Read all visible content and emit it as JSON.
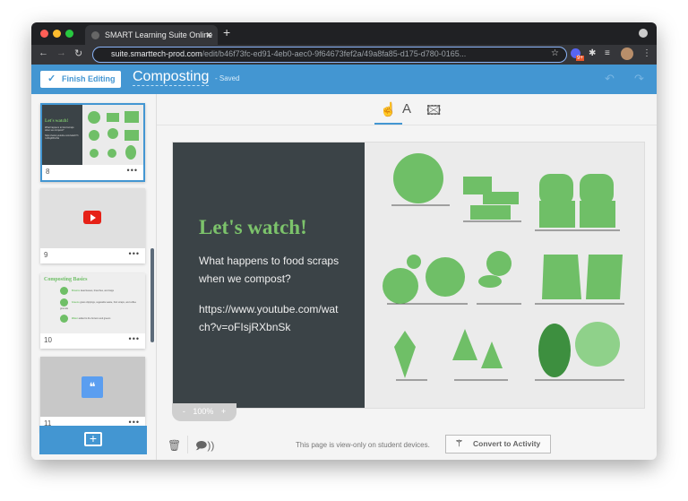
{
  "browser": {
    "tab_title": "SMART Learning Suite Online",
    "url_domain": "suite.smarttech-prod.com",
    "url_path": "/edit/b46f73fc-ed91-4eb0-aec0-9f64673fef2a/49a8fa85-d175-d780-0165...",
    "ext_badge": "9+"
  },
  "header": {
    "finish_label": "Finish Editing",
    "title": "Composting",
    "status": "- Saved"
  },
  "sidebar": {
    "pages": [
      {
        "number": "8",
        "more": "•••",
        "thumb_title": "Let's watch!",
        "thumb_text": "What happens to food scraps when we compost?",
        "thumb_link": "https://www.youtube.com/watch?v=oFIsjRXbnSk"
      },
      {
        "number": "9",
        "more": "•••",
        "icon": "youtube-icon"
      },
      {
        "number": "10",
        "more": "•••",
        "thumb_title": "Composting Basics",
        "items": [
          {
            "name": "Browns",
            "desc": "dead leaves, branches, and twigs"
          },
          {
            "name": "Greens",
            "desc": "grass clippings, vegetable waste, fruit scraps, and coffee grounds"
          },
          {
            "name": "Water",
            "desc": "added to the browns and greens"
          }
        ]
      },
      {
        "number": "11",
        "more": "•••",
        "icon": "chat-icon"
      }
    ]
  },
  "toolbar": {
    "tools": [
      "select-tool",
      "text-tool",
      "image-tool"
    ]
  },
  "slide": {
    "title": "Let's watch!",
    "text": "What happens to food scraps when we compost?",
    "link": "https://www.youtube.com/watch?v=oFIsjRXbnSk"
  },
  "zoom": {
    "minus": "-",
    "level": "100%",
    "plus": "+"
  },
  "footer": {
    "message": "This page is view-only on student devices.",
    "convert_label": "Convert to Activity"
  },
  "colors": {
    "accent": "#4396d2",
    "slide_dark": "#3b4347",
    "green": "#7cc36b"
  }
}
